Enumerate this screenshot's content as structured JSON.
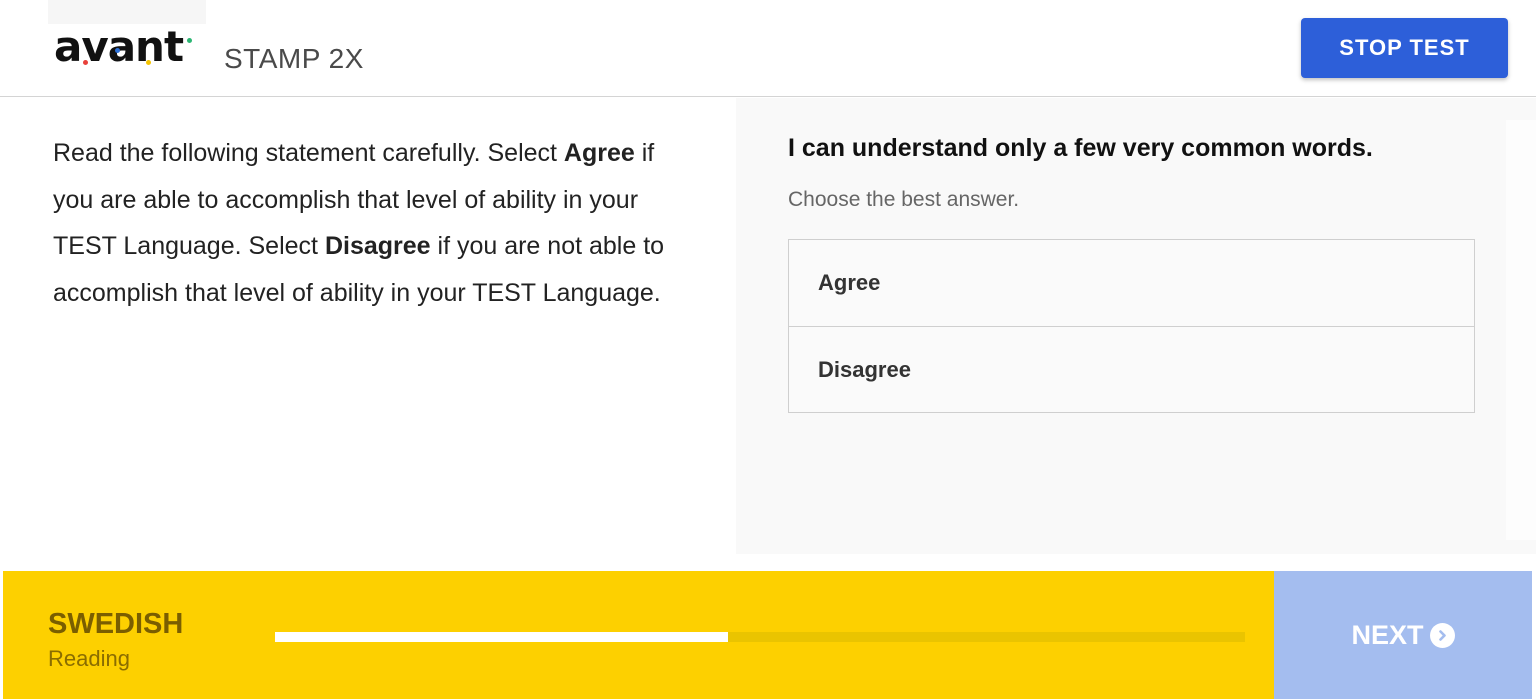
{
  "header": {
    "logo_text": "avant",
    "product_name": "STAMP 2X",
    "stop_button_label": "STOP TEST"
  },
  "instructions": {
    "part1": "Read the following statement carefully. Select ",
    "agree": "Agree",
    "part2": " if you are able to accomplish that level of ability in your TEST Language. Select ",
    "disagree": "Disagree",
    "part3": " if you are not able to accomplish that level of ability in your TEST Language."
  },
  "question": {
    "statement": "I can understand only a few very common words.",
    "hint": "Choose the best answer.",
    "options": [
      {
        "label": "Agree"
      },
      {
        "label": "Disagree"
      }
    ]
  },
  "footer": {
    "language": "SWEDISH",
    "skill": "Reading",
    "progress_fraction": 0.467,
    "next_label": "NEXT",
    "next_icon": "chevron-right-circle-icon"
  },
  "colors": {
    "accent_blue": "#2d5fd9",
    "footer_yellow": "#fdd000",
    "next_disabled": "#a4bdef"
  }
}
